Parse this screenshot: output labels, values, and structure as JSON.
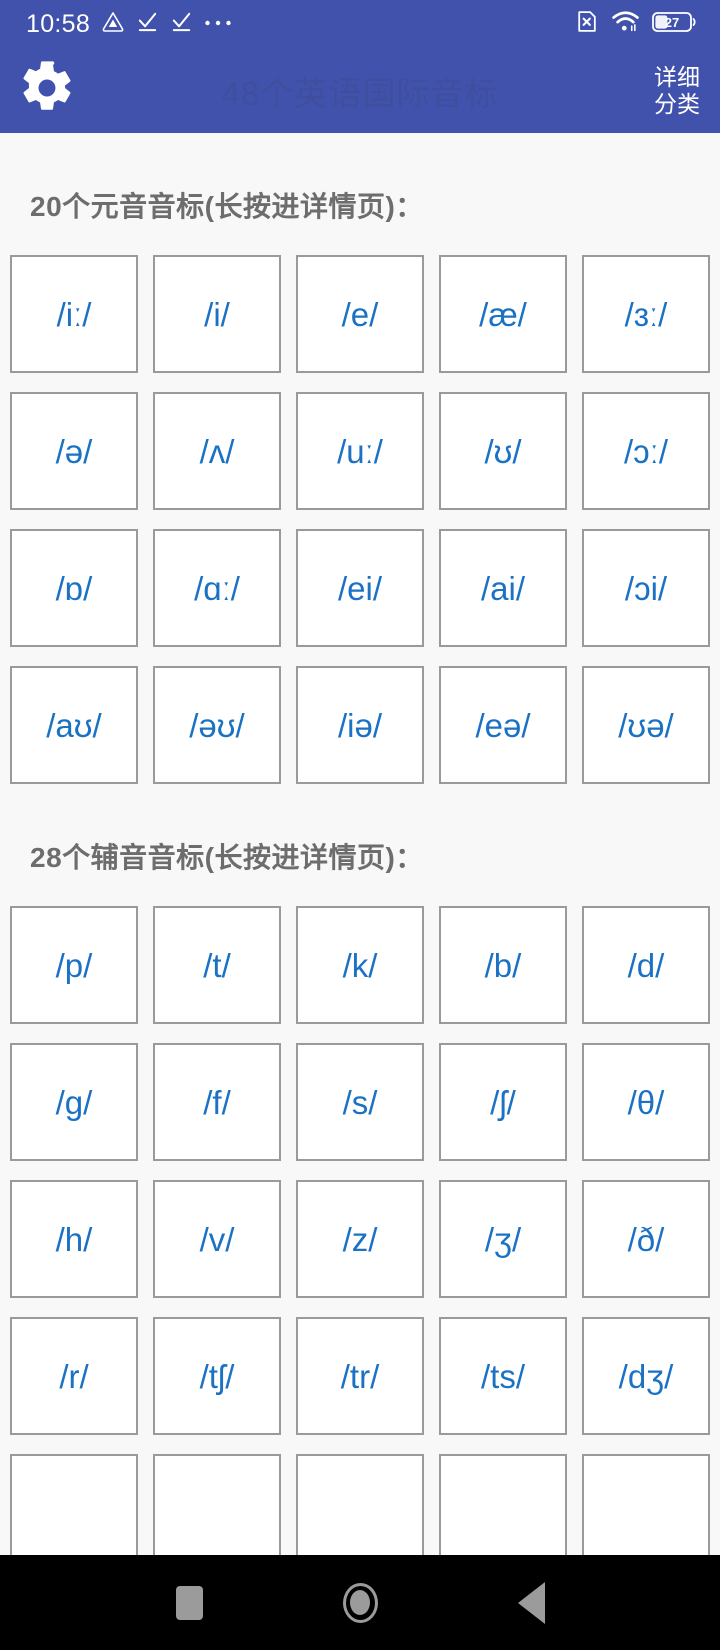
{
  "status_bar": {
    "time": "10:58",
    "icons_left": [
      "triangle-badge-icon",
      "check-download-icon",
      "check-download-icon",
      "more-dots-icon"
    ],
    "icons_right": [
      "no-sim-icon",
      "wifi-icon",
      "battery-icon"
    ],
    "battery_level": "27"
  },
  "app_bar": {
    "settings_icon": "gear-icon",
    "title": "48个英语国际音标",
    "action_line1": "详细",
    "action_line2": "分类"
  },
  "colors": {
    "brand": "#4152ad",
    "title_text": "#3f4f9e",
    "symbol": "#1b72c4",
    "cell_border": "#9a9a9a",
    "page_bg": "#f8f8f8",
    "section_title": "#6d6d6d",
    "nav_bg": "#000000",
    "nav_icon": "#9b9b9b"
  },
  "sections": [
    {
      "title": "20个元音音标(长按进详情页)：",
      "symbols": [
        "/iː/",
        "/i/",
        "/e/",
        "/æ/",
        "/ɜː/",
        "/ə/",
        "/ʌ/",
        "/uː/",
        "/ʊ/",
        "/ɔː/",
        "/ɒ/",
        "/ɑː/",
        "/ei/",
        "/ai/",
        "/ɔi/",
        "/aʊ/",
        "/əʊ/",
        "/iə/",
        "/eə/",
        "/ʊə/"
      ]
    },
    {
      "title": "28个辅音音标(长按进详情页)：",
      "symbols": [
        "/p/",
        "/t/",
        "/k/",
        "/b/",
        "/d/",
        "/g/",
        "/f/",
        "/s/",
        "/ʃ/",
        "/θ/",
        "/h/",
        "/v/",
        "/z/",
        "/ʒ/",
        "/ð/",
        "/r/",
        "/tʃ/",
        "/tr/",
        "/ts/",
        "/dʒ/",
        "",
        "",
        "",
        "",
        ""
      ]
    }
  ],
  "nav_bar": {
    "recents": "recents-square-icon",
    "home": "home-circle-icon",
    "back": "back-triangle-icon"
  }
}
